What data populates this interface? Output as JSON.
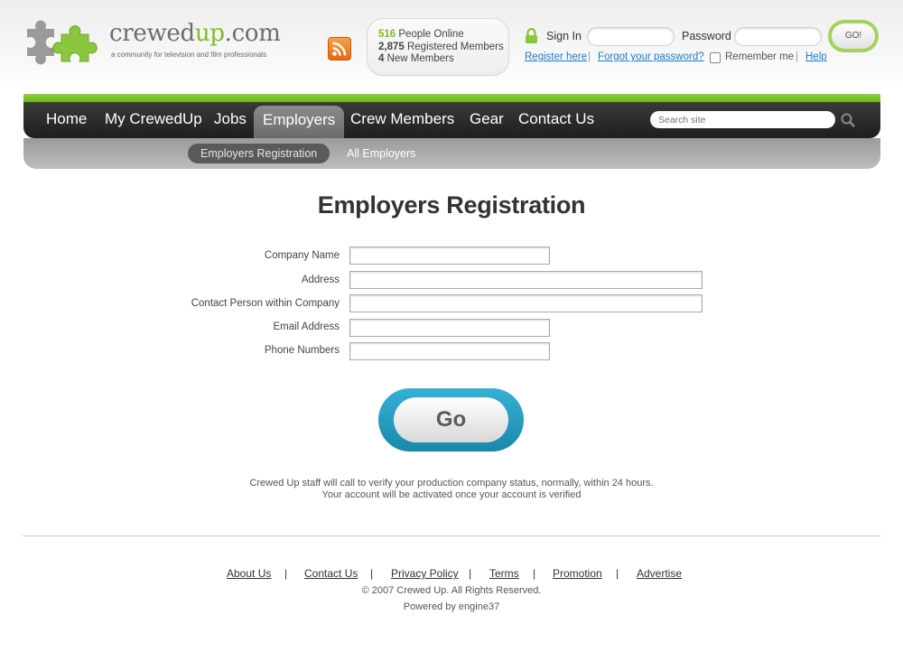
{
  "header": {
    "logo_main": "crewed",
    "logo_accent": "up",
    "logo_suffix": ".com",
    "tagline": "a community for television and film professionals",
    "stats": {
      "online_count": "516",
      "online_label": "People Online",
      "registered_count": "2,875",
      "registered_label": "Registered Members",
      "new_count": "4",
      "new_label": "New Members"
    },
    "sign_in_label": "Sign In",
    "password_label": "Password",
    "go_button": "GO!",
    "register_link": "Register here",
    "forgot_link": "Forgot your password?",
    "remember_label": "Remember me",
    "help_link": "Help",
    "separator": "|"
  },
  "nav": {
    "items": [
      "Home",
      "My CrewedUp",
      "Jobs",
      "Employers",
      "Crew Members",
      "Gear",
      "Contact Us"
    ],
    "active": "Employers",
    "search_placeholder": "Search site"
  },
  "sub_nav": {
    "items": [
      "Employers Registration",
      "All Employers"
    ],
    "active": "Employers Registration"
  },
  "form": {
    "title": "Employers Registration",
    "fields": [
      {
        "label": "Company Name",
        "value": ""
      },
      {
        "label": "Address",
        "value": ""
      },
      {
        "label": "Contact Person within Company",
        "value": ""
      },
      {
        "label": "Email Address",
        "value": ""
      },
      {
        "label": "Phone Numbers",
        "value": ""
      }
    ],
    "submit_label": "Go",
    "note_line1": "Crewed Up staff will call to verify your production company status, normally, within 24 hours.",
    "note_line2": "Your account will be activated once your account is verified"
  },
  "footer": {
    "links": [
      "About Us",
      "Contact Us",
      "Privacy Policy",
      "Terms",
      "Promotion",
      "Advertise"
    ],
    "separator": "|",
    "copyright": "© 2007 Crewed Up. All Rights Reserved.",
    "powered_by": "Powered by engine37"
  },
  "colors": {
    "brand_green": "#7cbf1e",
    "link_blue": "#1a7ad2",
    "nav_dark": "#262626",
    "go_button_blue": "#1f95bd"
  }
}
